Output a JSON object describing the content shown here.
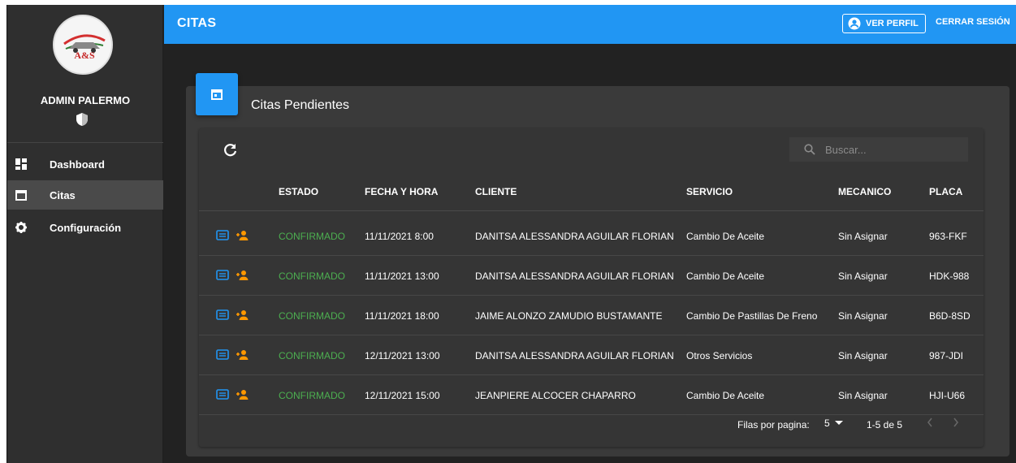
{
  "app": {
    "title": "CITAS"
  },
  "sidebar": {
    "logo_text": "A&S",
    "user_name": "ADMIN PALERMO",
    "items": [
      {
        "label": "Dashboard",
        "icon": "dashboard-icon"
      },
      {
        "label": "Citas",
        "icon": "calendar-icon",
        "active": true
      },
      {
        "label": "Configuración",
        "icon": "gear-icon"
      }
    ]
  },
  "header": {
    "profile_button": "VER PERFIL",
    "logout_button": "CERRAR SESIÓN"
  },
  "card": {
    "title": "Citas Pendientes"
  },
  "search": {
    "placeholder": "Buscar..."
  },
  "table": {
    "columns": [
      "ESTADO",
      "FECHA Y HORA",
      "CLIENTE",
      "SERVICIO",
      "MECANICO",
      "PLACA"
    ],
    "rows": [
      {
        "estado": "CONFIRMADO",
        "fecha": "11/11/2021 8:00",
        "cliente": "DANITSA ALESSANDRA AGUILAR FLORIAN",
        "servicio": "Cambio De Aceite",
        "mecanico": "Sin Asignar",
        "placa": "963-FKF"
      },
      {
        "estado": "CONFIRMADO",
        "fecha": "11/11/2021 13:00",
        "cliente": "DANITSA ALESSANDRA AGUILAR FLORIAN",
        "servicio": "Cambio De Aceite",
        "mecanico": "Sin Asignar",
        "placa": "HDK-988"
      },
      {
        "estado": "CONFIRMADO",
        "fecha": "11/11/2021 18:00",
        "cliente": "JAIME ALONZO ZAMUDIO BUSTAMANTE",
        "servicio": "Cambio De Pastillas De Freno",
        "mecanico": "Sin Asignar",
        "placa": "B6D-8SD"
      },
      {
        "estado": "CONFIRMADO",
        "fecha": "12/11/2021 13:00",
        "cliente": "DANITSA ALESSANDRA AGUILAR FLORIAN",
        "servicio": "Otros Servicios",
        "mecanico": "Sin Asignar",
        "placa": "987-JDI"
      },
      {
        "estado": "CONFIRMADO",
        "fecha": "12/11/2021 15:00",
        "cliente": "JEANPIERE ALCOCER CHAPARRO",
        "servicio": "Cambio De Aceite",
        "mecanico": "Sin Asignar",
        "placa": "HJI-U66"
      }
    ]
  },
  "pagination": {
    "rows_per_page_label": "Filas por pagina:",
    "rows_per_page": "5",
    "range": "1-5 de 5"
  },
  "colors": {
    "accent": "#2196f3",
    "status_confirmed": "#4caf50",
    "assign_icon": "#ff9800"
  }
}
